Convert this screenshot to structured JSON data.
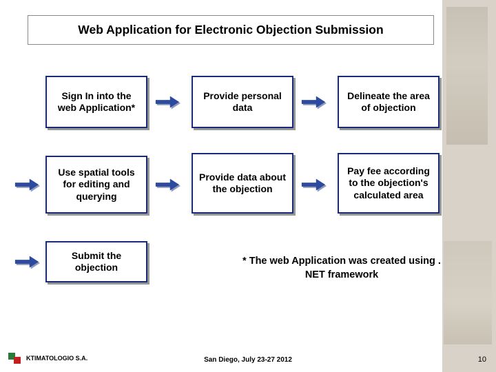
{
  "title": "Web Application for Electronic Objection Submission",
  "steps": {
    "s1": "Sign In into the web Application*",
    "s2": "Provide personal data",
    "s3": "Delineate the area of objection",
    "s4": "Use spatial tools for editing and querying",
    "s5": "Provide data about the objection",
    "s6": "Pay fee according to the objection's calculated area",
    "s7": "Submit the objection"
  },
  "footnote_star": "*",
  "footnote": " The web Application was created using . NET framework",
  "footer": {
    "org": "KTIMATOLOGIO S.A.",
    "venue": "San Diego, July 23-27 2012",
    "page": "10"
  }
}
